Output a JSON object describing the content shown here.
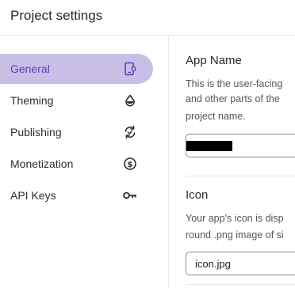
{
  "header": {
    "title": "Project settings"
  },
  "sidebar": {
    "items": [
      {
        "label": "General",
        "icon": "phone-settings-icon",
        "active": true
      },
      {
        "label": "Theming",
        "icon": "droplet-icon",
        "active": false
      },
      {
        "label": "Publishing",
        "icon": "sync-icon",
        "active": false
      },
      {
        "label": "Monetization",
        "icon": "dollar-circle-icon",
        "active": false
      },
      {
        "label": "API Keys",
        "icon": "key-icon",
        "active": false
      }
    ]
  },
  "main": {
    "app_name": {
      "title": "App Name",
      "description_lines": [
        "This is the user-facing",
        "and other parts of the",
        "project name."
      ],
      "value_redacted": true
    },
    "icon": {
      "title": "Icon",
      "description_lines": [
        "Your app's icon is disp",
        "round .png image of si"
      ],
      "value": "icon.jpg"
    }
  },
  "colors": {
    "accent": "#5a3fb3",
    "active_bg": "#c9bfe6",
    "border": "#e6e6e6",
    "text": "#2a2a2e",
    "muted_text": "#55555c"
  }
}
